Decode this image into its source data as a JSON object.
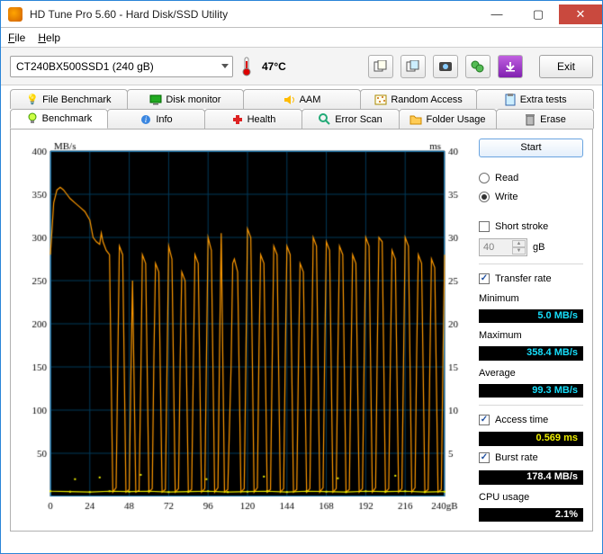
{
  "window": {
    "title": "HD Tune Pro 5.60 - Hard Disk/SSD Utility"
  },
  "menu": {
    "file": "File",
    "help": "Help"
  },
  "toolbar": {
    "drive": "CT240BX500SSD1 (240 gB)",
    "temp": "47°C",
    "exit": "Exit"
  },
  "tabs_row1": {
    "file_benchmark": "File Benchmark",
    "disk_monitor": "Disk monitor",
    "aam": "AAM",
    "random_access": "Random Access",
    "extra_tests": "Extra tests"
  },
  "tabs_row2": {
    "benchmark": "Benchmark",
    "info": "Info",
    "health": "Health",
    "error_scan": "Error Scan",
    "folder_usage": "Folder Usage",
    "erase": "Erase"
  },
  "side": {
    "start": "Start",
    "read": "Read",
    "write": "Write",
    "short_stroke": "Short stroke",
    "short_stroke_value": "40",
    "short_stroke_unit": "gB",
    "transfer_rate": "Transfer rate",
    "minimum": "Minimum",
    "minimum_val": "5.0 MB/s",
    "maximum": "Maximum",
    "maximum_val": "358.4 MB/s",
    "average": "Average",
    "average_val": "99.3 MB/s",
    "access_time": "Access time",
    "access_time_val": "0.569 ms",
    "burst_rate": "Burst rate",
    "burst_rate_val": "178.4 MB/s",
    "cpu_usage": "CPU usage",
    "cpu_usage_val": "2.1%"
  },
  "chart_data": {
    "type": "line",
    "title": "",
    "y_left_label": "MB/s",
    "y_right_label": "ms",
    "x_unit": "gB",
    "xlim": [
      0,
      240
    ],
    "ylim_left": [
      0,
      400
    ],
    "ylim_right": [
      0,
      40
    ],
    "x_ticks": [
      0,
      24,
      48,
      72,
      96,
      120,
      144,
      168,
      192,
      216,
      240
    ],
    "y_left_ticks": [
      50,
      100,
      150,
      200,
      250,
      300,
      350,
      400
    ],
    "y_right_ticks": [
      5,
      10,
      15,
      20,
      25,
      30,
      35,
      40
    ],
    "series": [
      {
        "name": "transfer_rate",
        "color": "#ff9a00",
        "axis": "left",
        "x": [
          0,
          2,
          4,
          6,
          8,
          10,
          12,
          15,
          18,
          21,
          24,
          26,
          28,
          30,
          31,
          32,
          34,
          36,
          38,
          40,
          41,
          42,
          44,
          46,
          48,
          49,
          50,
          52,
          54,
          55,
          56,
          58,
          60,
          62,
          63,
          64,
          66,
          68,
          70,
          71,
          72,
          74,
          76,
          78,
          79,
          80,
          82,
          84,
          86,
          87,
          88,
          90,
          92,
          94,
          95,
          96,
          98,
          100,
          102,
          103,
          104,
          106,
          108,
          110,
          111,
          112,
          114,
          116,
          118,
          119,
          120,
          122,
          124,
          126,
          127,
          128,
          130,
          132,
          134,
          135,
          136,
          138,
          140,
          142,
          143,
          144,
          146,
          148,
          150,
          151,
          152,
          154,
          156,
          158,
          159,
          160,
          162,
          164,
          166,
          167,
          168,
          170,
          172,
          174,
          175,
          176,
          178,
          180,
          182,
          183,
          184,
          186,
          188,
          190,
          191,
          192,
          194,
          196,
          198,
          199,
          200,
          202,
          204,
          206,
          207,
          208,
          210,
          212,
          214,
          215,
          216,
          218,
          220,
          222,
          223,
          224,
          226,
          228,
          230,
          231,
          232,
          234,
          236,
          238,
          239,
          240
        ],
        "y": [
          280,
          340,
          355,
          358,
          355,
          350,
          345,
          340,
          335,
          330,
          320,
          300,
          295,
          292,
          305,
          295,
          285,
          280,
          5,
          10,
          150,
          290,
          280,
          5,
          8,
          140,
          250,
          5,
          7,
          130,
          280,
          270,
          5,
          9,
          160,
          270,
          260,
          5,
          8,
          150,
          290,
          275,
          5,
          9,
          155,
          260,
          250,
          5,
          8,
          145,
          280,
          270,
          5,
          9,
          160,
          300,
          285,
          5,
          10,
          170,
          305,
          5,
          8,
          150,
          270,
          275,
          260,
          5,
          9,
          155,
          310,
          300,
          5,
          10,
          170,
          280,
          270,
          5,
          8,
          150,
          290,
          280,
          5,
          9,
          160,
          290,
          280,
          5,
          8,
          150,
          270,
          260,
          5,
          9,
          155,
          300,
          290,
          5,
          10,
          165,
          295,
          285,
          5,
          9,
          160,
          290,
          280,
          5,
          8,
          150,
          280,
          270,
          5,
          9,
          155,
          300,
          290,
          5,
          10,
          170,
          300,
          295,
          5,
          9,
          160,
          285,
          275,
          5,
          9,
          155,
          300,
          290,
          5,
          10,
          165,
          280,
          270,
          5,
          8,
          150,
          275,
          265,
          5,
          8,
          155,
          280
        ]
      },
      {
        "name": "access_time",
        "color": "#eded00",
        "axis": "right",
        "x": [
          0,
          12,
          24,
          36,
          48,
          60,
          72,
          84,
          96,
          108,
          120,
          132,
          144,
          156,
          168,
          180,
          192,
          204,
          216,
          228,
          240
        ],
        "y": [
          0.6,
          0.55,
          0.5,
          0.6,
          0.55,
          0.6,
          0.5,
          0.55,
          0.6,
          0.5,
          0.55,
          0.6,
          0.5,
          0.6,
          0.55,
          0.5,
          0.6,
          0.55,
          0.6,
          0.5,
          0.55
        ]
      }
    ],
    "access_scatter_outliers_ms": [
      2.0,
      2.2,
      2.5,
      2.0,
      2.3,
      2.1,
      2.4
    ],
    "access_scatter_outliers_x": [
      15,
      30,
      55,
      95,
      130,
      175,
      210
    ]
  }
}
